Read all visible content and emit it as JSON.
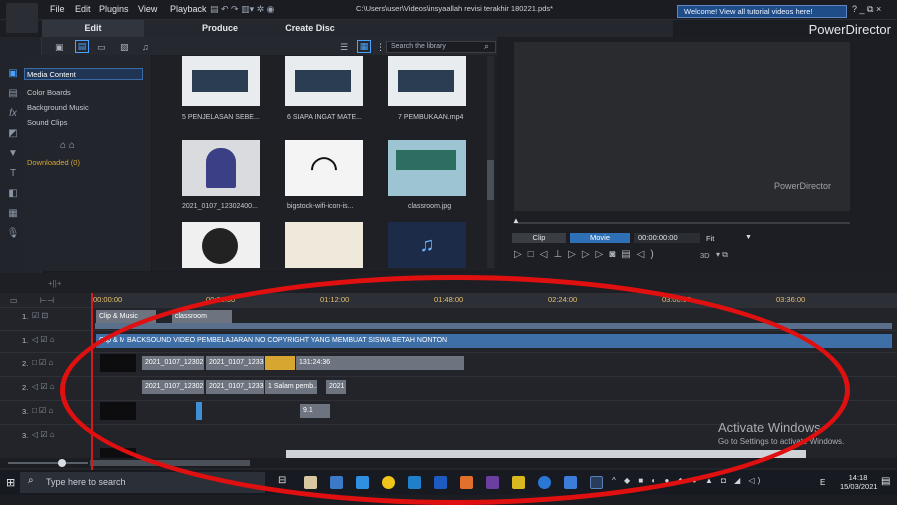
{
  "menubar": {
    "items": [
      "File",
      "Edit",
      "Plugins",
      "View",
      "Playback"
    ],
    "file_path": "C:\\Users\\user\\Videos\\insyaallah revisi terakhir 180221.pds*",
    "welcome_text": "Welcome! View all tutorial videos here!",
    "window_controls": "? _ ⧉ ×"
  },
  "modes": {
    "edit": "Edit",
    "produce": "Produce",
    "create_disc": "Create Disc",
    "brand": "PowerDirector"
  },
  "library": {
    "search_placeholder": "Search the library",
    "categories": [
      "Media Content",
      "Color Boards",
      "Background Music",
      "Sound Clips"
    ],
    "downloaded": "Downloaded  (0)",
    "items": [
      {
        "caption": "5 PENJELASAN SEBE..."
      },
      {
        "caption": "6 SIAPA INGAT MATE..."
      },
      {
        "caption": "7 PEMBUKAAN.mp4"
      },
      {
        "caption": "2021_0107_12302400..."
      },
      {
        "caption": "bigstock-wifi-icon-is..."
      },
      {
        "caption": "classroom.jpg"
      }
    ]
  },
  "preview": {
    "watermark": "PowerDirector",
    "clip_tab": "Clip",
    "movie_tab": "Movie",
    "timecode": "00:00:00:00",
    "fit": "Fit",
    "mode_3d": "3D"
  },
  "timeline": {
    "ruler": [
      "00:00:00",
      "00:36:00",
      "01:12:00",
      "01:48:00",
      "02:24:00",
      "03:00:00",
      "03:36:00"
    ],
    "tracks": [
      {
        "label": "1.",
        "clips": [
          "Clip & Music",
          "classroom"
        ]
      },
      {
        "label": "1.",
        "clips": [
          "Clip & Music",
          "BACKSOUND VIDEO PEMBELAJARAN NO COPYRIGHT YANG MEMBUAT SISWA BETAH NONTON"
        ]
      },
      {
        "label": "2.",
        "clips": [
          "2021_0107_12302",
          "2021_0107_1233",
          "131:24:36"
        ]
      },
      {
        "label": "2.",
        "clips": [
          "2021_0107_12302",
          "2021_0107_1233",
          "1 Salam pemb...",
          "2021"
        ]
      },
      {
        "label": "3.",
        "clips": [
          "9.1"
        ]
      },
      {
        "label": "3.",
        "clips": []
      }
    ]
  },
  "watermark": {
    "line1": "Activate Windows",
    "line2": "Go to Settings to activate Windows."
  },
  "taskbar": {
    "search": "Type here to search",
    "time": "14:18",
    "date": "15/03/2021",
    "lang": "E"
  },
  "colors": {
    "accent": "#2f6fb5",
    "highlight": "#e01010",
    "clip_blue": "#3f6fa7",
    "clip_gold": "#d6a631"
  }
}
